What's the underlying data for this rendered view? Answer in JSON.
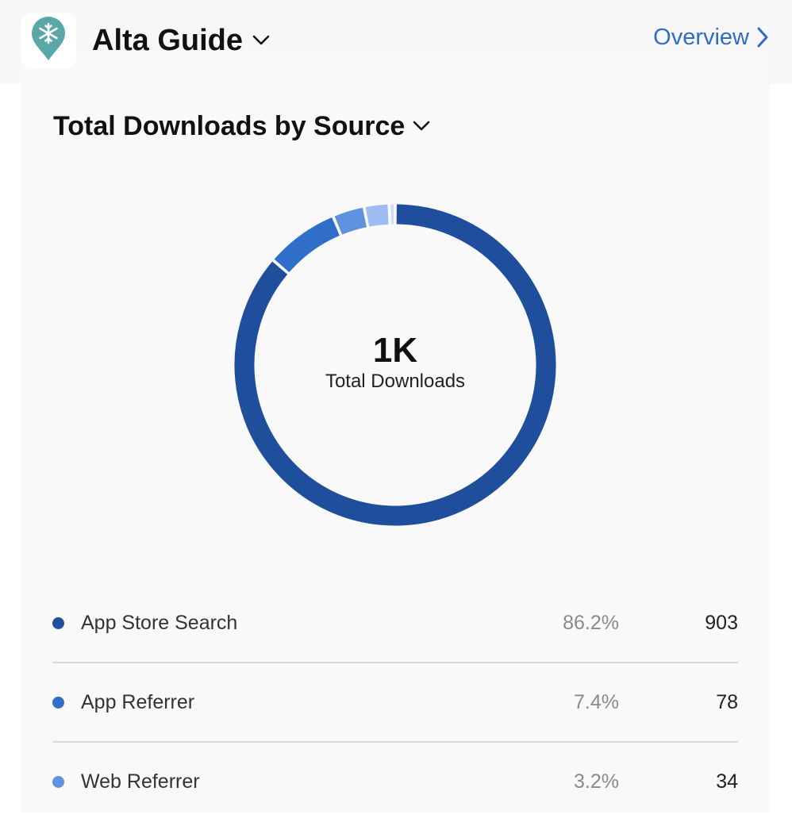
{
  "app": {
    "name": "Alta Guide",
    "icon": "map-pin-snowflake-icon",
    "icon_color": "#5aa7a8"
  },
  "nav": {
    "overview_label": "Overview",
    "link_color": "#2f6dc4"
  },
  "chart_data": {
    "type": "pie",
    "variant": "donut",
    "title": "Total Downloads by Source",
    "center_value": "1K",
    "center_label": "Total Downloads",
    "series": [
      {
        "name": "App Store Search",
        "percent": "86.2%",
        "value": 903,
        "color": "#1f4e9c"
      },
      {
        "name": "App Referrer",
        "percent": "7.4%",
        "value": 78,
        "color": "#2f6fc9"
      },
      {
        "name": "Web Referrer",
        "percent": "3.2%",
        "value": 34,
        "color": "#5f93e0"
      }
    ],
    "unlisted_slices": [
      {
        "fraction": 0.025,
        "color": "#9dbcf2"
      },
      {
        "fraction": 0.006,
        "color": "#cfdcf3"
      }
    ]
  }
}
